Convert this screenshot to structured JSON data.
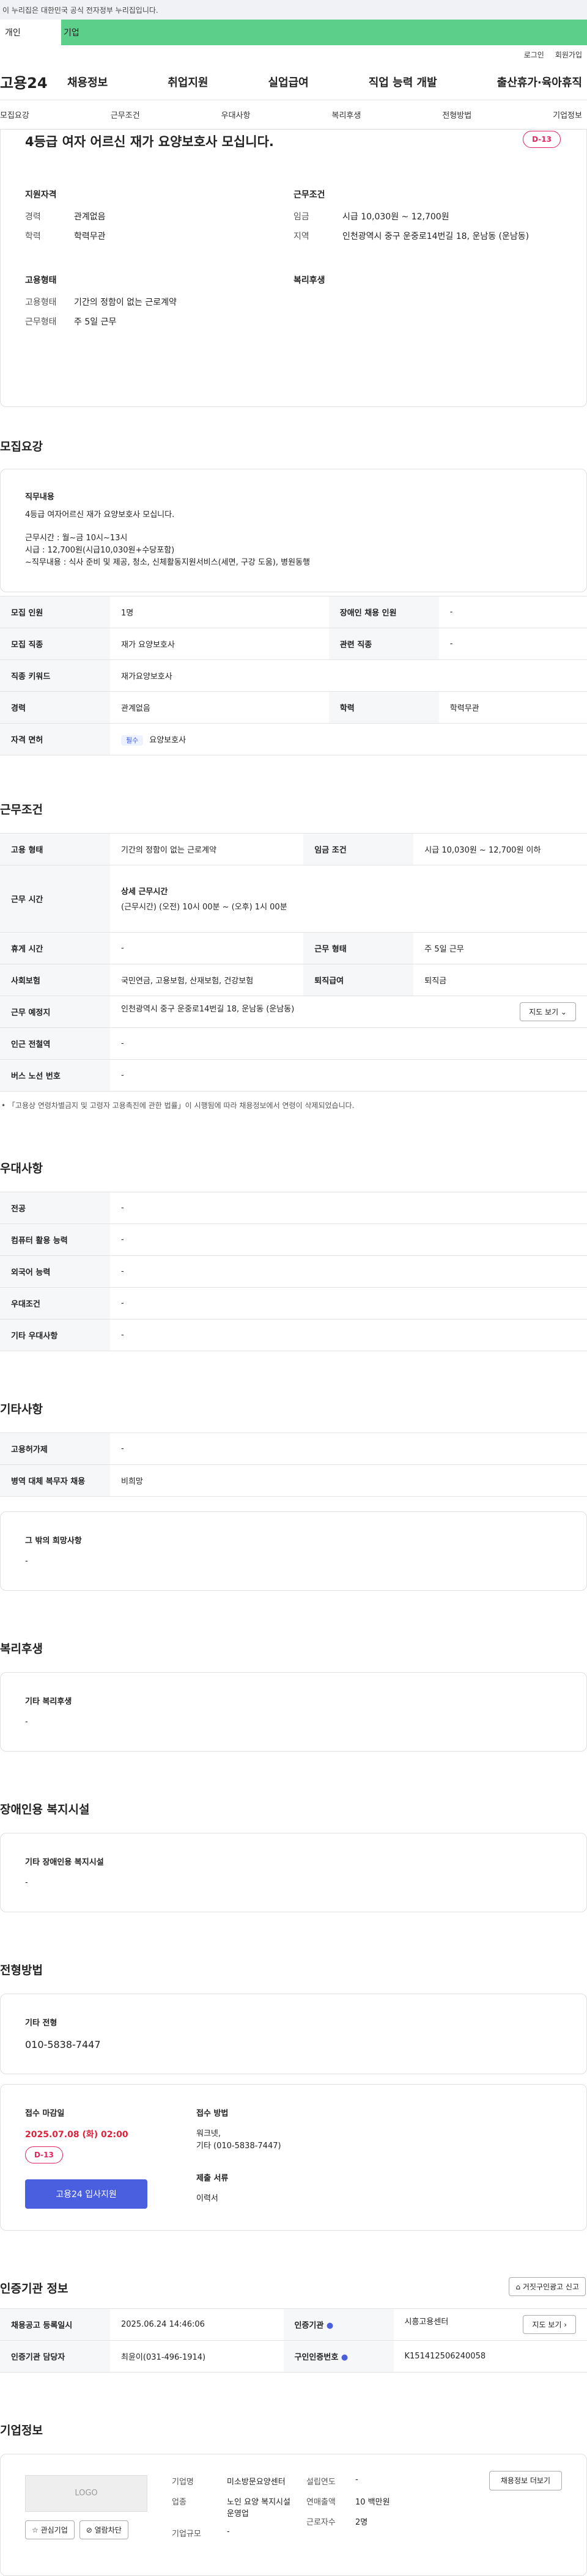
{
  "gov_strip": "이 누리집은 대한민국 공식 전자정부 누리집입니다.",
  "tabs": {
    "personal": "개인",
    "company": "기업"
  },
  "util": {
    "login": "로그인",
    "signup": "회원가입"
  },
  "logo": "고용24",
  "gnb": [
    "채용정보",
    "취업지원",
    "실업급여",
    "직업 능력 개발",
    "출산휴가·육아휴직"
  ],
  "lnb": [
    "모집요강",
    "근무조건",
    "우대사항",
    "복리후생",
    "전형방법",
    "기업정보"
  ],
  "summary": {
    "title": "4등급 여자 어르신 재가 요양보호사 모십니다.",
    "dday": "D-13",
    "qual_h": "지원자격",
    "qual": [
      [
        "경력",
        "관계없음"
      ],
      [
        "학력",
        "학력무관"
      ]
    ],
    "cond_h": "근무조건",
    "cond": [
      [
        "임금",
        "시급 10,030원 ~ 12,700원"
      ],
      [
        "지역",
        "인천광역시 중구 운중로14번길 18, 운남동 (운남동)"
      ]
    ],
    "emp_h": "고용형태",
    "emp": [
      [
        "고용형태",
        "기간의 정함이 없는 근로계약"
      ],
      [
        "근무형태",
        "주 5일 근무"
      ]
    ],
    "welfare_h": "복리후생"
  },
  "recruit": {
    "title": "모집요강",
    "duty_h": "직무내용",
    "duty_lines": [
      "4등급 여자어르신 재가 요양보호사 모십니다.",
      "",
      "근무시간 : 월~금 10시~13시",
      "시급 : 12,700원(시급10,030원+수당포함)",
      "~직무내용 : 식사 준비 및 제공, 청소, 신체활동지원서비스(세면, 구강 도움), 병원동행"
    ],
    "rows": [
      [
        "모집 인원",
        "1명",
        "장애인 채용 인원",
        "-"
      ],
      [
        "모집 직종",
        "재가 요양보호사",
        "관련 직종",
        "-"
      ],
      [
        "직종 키워드",
        "재가요양보호사",
        "",
        ""
      ],
      [
        "경력",
        "관계없음",
        "학력",
        "학력무관"
      ]
    ],
    "license_k": "자격 면허",
    "license_tag": "필수",
    "license_v": "요양보호사"
  },
  "work": {
    "title": "근무조건",
    "emp_k": "고용 형태",
    "emp_v": "기간의 정함이 없는 근로계약",
    "wage_k": "임금 조건",
    "wage_v": "시급 10,030원 ~ 12,700원 이하",
    "time_k": "근무 시간",
    "time_h": "상세 근무시간",
    "time_v": "(근무시간) (오전) 10시 00분 ~ (오후) 1시 00분",
    "rest_k": "휴게 시간",
    "rest_v": "-",
    "shape_k": "근무 형태",
    "shape_v": "주 5일 근무",
    "ins_k": "사회보험",
    "ins_v": "국민연금, 고용보험, 산재보험, 건강보험",
    "ret_k": "퇴직급여",
    "ret_v": "퇴직금",
    "place_k": "근무 예정지",
    "place_v": "인천광역시 중구 운중로14번길 18, 운남동 (운남동)",
    "map_btn": "지도 보기 ⌄",
    "station_k": "인근 전철역",
    "station_v": "-",
    "bus_k": "버스 노선 번호",
    "bus_v": "-",
    "note": "「고용상 연령차별금지 및 고령자 고용촉진에 관한 법률」이 시행됨에 따라 채용정보에서 연령이 삭제되었습니다."
  },
  "pref": {
    "title": "우대사항",
    "rows": [
      [
        "전공",
        "-"
      ],
      [
        "컴퓨터 활용 능력",
        "-"
      ],
      [
        "외국어 능력",
        "-"
      ],
      [
        "우대조건",
        "-"
      ],
      [
        "기타 우대사항",
        "-"
      ]
    ]
  },
  "etc": {
    "title": "기타사항",
    "rows": [
      [
        "고용허가제",
        "-"
      ],
      [
        "병역 대체 복무자 채용",
        "비희망"
      ]
    ],
    "other_h": "그 밖의 희망사항",
    "other_v": "-"
  },
  "welfare": {
    "title": "복리후생",
    "h": "기타 복리후생",
    "v": "-"
  },
  "disabled": {
    "title": "장애인용 복지시설",
    "h": "기타 장애인용 복지시설",
    "v": "-"
  },
  "selection": {
    "title": "전형방법",
    "h": "기타 전형",
    "v": "010-5838-7447",
    "deadline_h": "접수 마감일",
    "deadline_v": "2025.07.08 (화) 02:00",
    "dday": "D-13",
    "apply_btn": "고용24 입사지원",
    "method_h": "접수 방법",
    "method_v1": "워크넷,",
    "method_v2": "기타 (010-5838-7447)",
    "docs_h": "제출 서류",
    "docs_v": "이력서"
  },
  "cert": {
    "title": "인증기관 정보",
    "report_btn": "거짓구인광고 신고",
    "rows": [
      [
        "채용공고 등록일시",
        "2025.06.24 14:46:06",
        "인증기관",
        "시흥고용센터"
      ],
      [
        "인증기관 담당자",
        "최윤이(031-496-1914)",
        "구인인증번호",
        "K151412506240058"
      ]
    ],
    "map_btn": "지도 보기 ›"
  },
  "corp": {
    "title": "기업정보",
    "logo": "LOGO",
    "fav": "관심기업",
    "block": "열람차단",
    "name_k": "기업명",
    "name_v": "미소방문요양센터",
    "ind_k": "업종",
    "ind_v": "노인 요양 복지시설 운영업",
    "scale_k": "기업규모",
    "scale_v": "-",
    "year_k": "설립연도",
    "year_v": "-",
    "sales_k": "연매출액",
    "sales_v": "10 백만원",
    "emp_k": "근로자수",
    "emp_v": "2명",
    "jobs_btn": "채용정보 더보기"
  }
}
